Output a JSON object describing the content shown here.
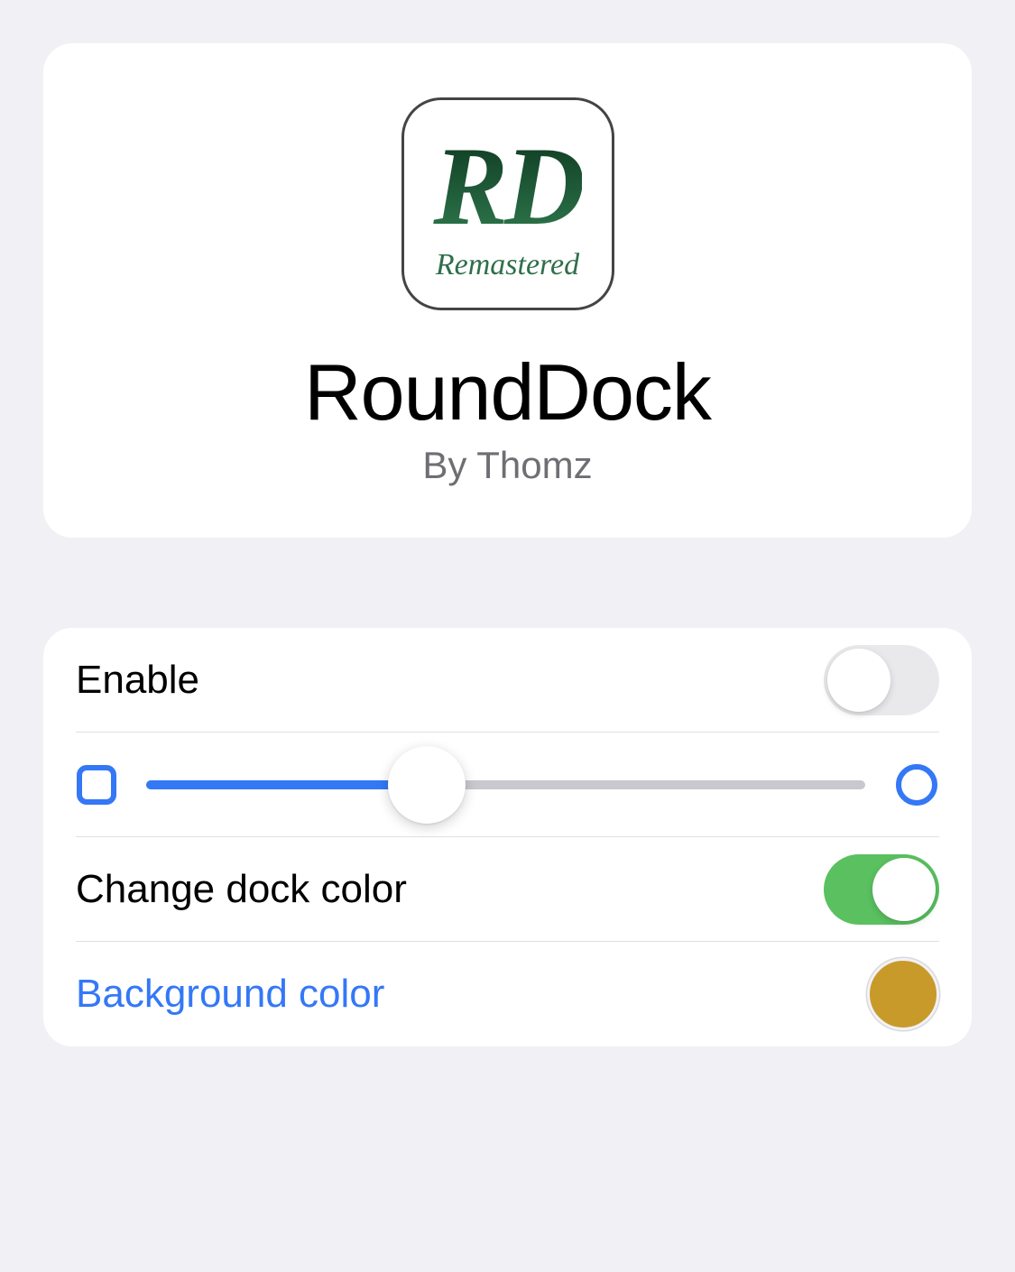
{
  "logo": {
    "monogram": "RD",
    "tagline": "Remastered"
  },
  "header": {
    "title": "RoundDock",
    "subtitle": "By Thomz"
  },
  "settings": {
    "enable": {
      "label": "Enable",
      "on": false
    },
    "radius_slider": {
      "value": 39,
      "min": 0,
      "max": 100,
      "min_icon": "rounded-square-icon",
      "max_icon": "circle-icon"
    },
    "change_color": {
      "label": "Change dock color",
      "on": true
    },
    "background_color": {
      "label": "Background color",
      "value": "#c89a2a"
    }
  },
  "colors": {
    "accent": "#3478f6",
    "toggle_on": "#5ac060"
  }
}
